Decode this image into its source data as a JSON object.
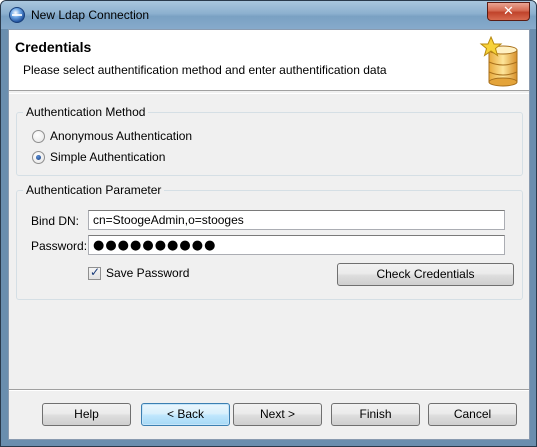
{
  "window": {
    "title": "New Ldap Connection",
    "close_symbol": "✕"
  },
  "banner": {
    "title": "Credentials",
    "description": "Please select authentification method and enter authentification data",
    "icon": "database-star-icon"
  },
  "auth_method": {
    "group_label": "Authentication Method",
    "options": [
      {
        "label": "Anonymous Authentication",
        "checked": false
      },
      {
        "label": "Simple Authentication",
        "checked": true
      }
    ]
  },
  "auth_params": {
    "group_label": "Authentication Parameter",
    "bind_dn_label": "Bind DN:",
    "bind_dn_value": "cn=StoogeAdmin,o=stooges",
    "password_label": "Password:",
    "password_masked": "●●●●●●●●●●",
    "save_password_label": "Save Password",
    "save_password_checked": true,
    "check_button_label": "Check Credentials"
  },
  "buttons": {
    "help": "Help",
    "back": "< Back",
    "next": "Next >",
    "finish": "Finish",
    "cancel": "Cancel"
  },
  "colors": {
    "title_bar": "#8cb0cf",
    "close_button": "#c0432b",
    "default_button_border": "#3c7fb1"
  }
}
